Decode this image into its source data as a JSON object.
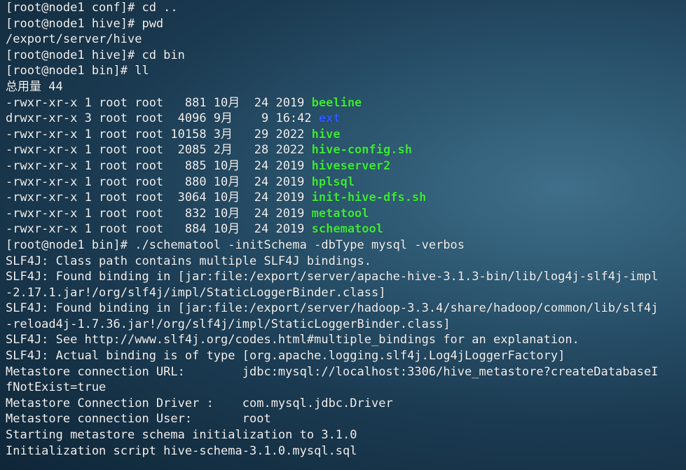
{
  "terminal": {
    "lines": [
      {
        "text": "[root@node1 conf]# cd .."
      },
      {
        "text": "[root@node1 hive]# pwd"
      },
      {
        "text": "/export/server/hive"
      },
      {
        "text": "[root@node1 hive]# cd bin"
      },
      {
        "text": "[root@node1 bin]# ll"
      },
      {
        "text": "总用量 44"
      },
      {
        "prefix": "-rwxr-xr-x 1 root root   881 10月  24 2019 ",
        "name": "beeline",
        "kind": "exec"
      },
      {
        "prefix": "drwxr-xr-x 3 root root  4096 9月    9 16:42 ",
        "name": "ext",
        "kind": "dir"
      },
      {
        "prefix": "-rwxr-xr-x 1 root root 10158 3月   29 2022 ",
        "name": "hive",
        "kind": "exec"
      },
      {
        "prefix": "-rwxr-xr-x 1 root root  2085 2月   28 2022 ",
        "name": "hive-config.sh",
        "kind": "exec"
      },
      {
        "prefix": "-rwxr-xr-x 1 root root   885 10月  24 2019 ",
        "name": "hiveserver2",
        "kind": "exec"
      },
      {
        "prefix": "-rwxr-xr-x 1 root root   880 10月  24 2019 ",
        "name": "hplsql",
        "kind": "exec"
      },
      {
        "prefix": "-rwxr-xr-x 1 root root  3064 10月  24 2019 ",
        "name": "init-hive-dfs.sh",
        "kind": "exec"
      },
      {
        "prefix": "-rwxr-xr-x 1 root root   832 10月  24 2019 ",
        "name": "metatool",
        "kind": "exec"
      },
      {
        "prefix": "-rwxr-xr-x 1 root root   884 10月  24 2019 ",
        "name": "schematool",
        "kind": "exec"
      },
      {
        "text": "[root@node1 bin]# ./schematool -initSchema -dbType mysql -verbos"
      },
      {
        "text": "SLF4J: Class path contains multiple SLF4J bindings."
      },
      {
        "text": "SLF4J: Found binding in [jar:file:/export/server/apache-hive-3.1.3-bin/lib/log4j-slf4j-impl"
      },
      {
        "text": "-2.17.1.jar!/org/slf4j/impl/StaticLoggerBinder.class]"
      },
      {
        "text": "SLF4J: Found binding in [jar:file:/export/server/hadoop-3.3.4/share/hadoop/common/lib/slf4j"
      },
      {
        "text": "-reload4j-1.7.36.jar!/org/slf4j/impl/StaticLoggerBinder.class]"
      },
      {
        "text": "SLF4J: See http://www.slf4j.org/codes.html#multiple_bindings for an explanation."
      },
      {
        "text": "SLF4J: Actual binding is of type [org.apache.logging.slf4j.Log4jLoggerFactory]"
      },
      {
        "text": "Metastore connection URL:        jdbc:mysql://localhost:3306/hive_metastore?createDatabaseI"
      },
      {
        "text": "fNotExist=true"
      },
      {
        "text": "Metastore Connection Driver :    com.mysql.jdbc.Driver"
      },
      {
        "text": "Metastore connection User:       root"
      },
      {
        "text": "Starting metastore schema initialization to 3.1.0"
      },
      {
        "text": "Initialization script hive-schema-3.1.0.mysql.sql"
      }
    ]
  }
}
